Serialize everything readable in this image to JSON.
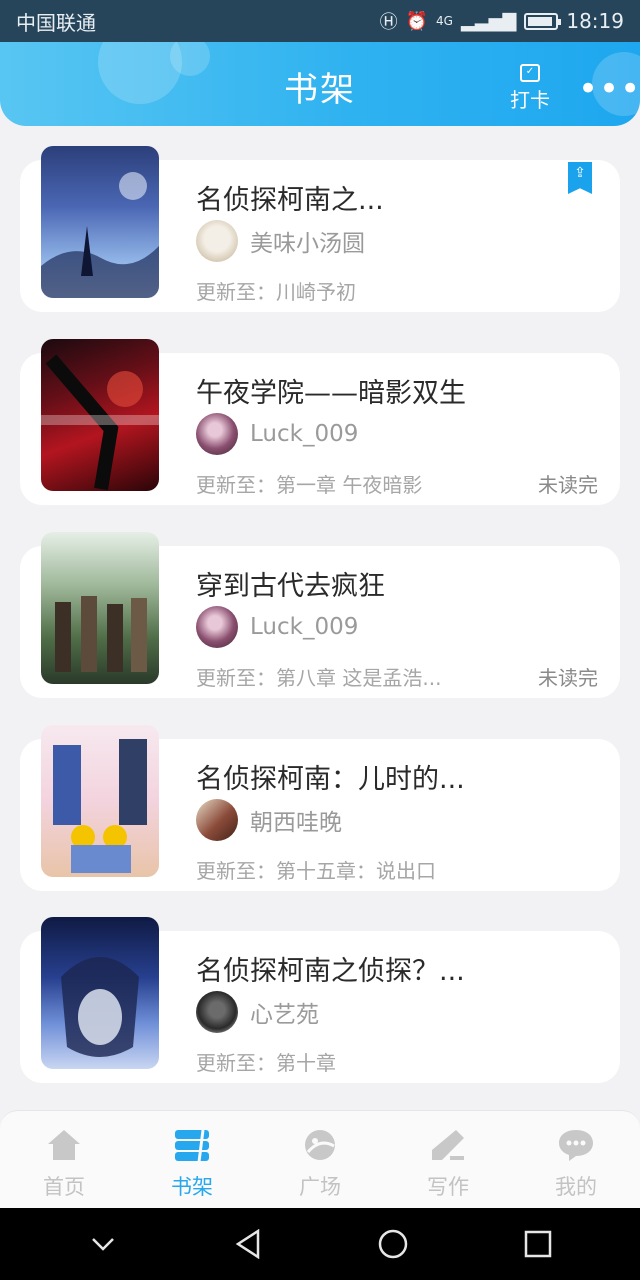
{
  "status_bar": {
    "carrier": "中国联通",
    "network": "4G",
    "time": "18:19",
    "battery_level": 0.9
  },
  "header": {
    "title": "书架",
    "checkin_label": "打卡",
    "more_label": "•••"
  },
  "books": [
    {
      "title": "名侦探柯南之...",
      "author": "美味小汤圆",
      "update": "更新至：川崎予初",
      "status": "",
      "pinned": true
    },
    {
      "title": "午夜学院——暗影双生",
      "author": "Luck_009",
      "update": "更新至：第一章  午夜暗影",
      "status": "未读完",
      "pinned": false
    },
    {
      "title": "穿到古代去疯狂",
      "author": "Luck_009",
      "update": "更新至：第八章  这是孟浩...",
      "status": "未读完",
      "pinned": false
    },
    {
      "title": "名侦探柯南：儿时的...",
      "author": "朝西哇晚",
      "update": "更新至：第十五章：说出口",
      "status": "",
      "pinned": false
    },
    {
      "title": "名侦探柯南之侦探？...",
      "author": "心艺苑",
      "update": "更新至：第十章",
      "status": "",
      "pinned": false
    }
  ],
  "bottom_nav": [
    {
      "label": "首页",
      "icon": "home-icon",
      "active": false
    },
    {
      "label": "书架",
      "icon": "bookshelf-icon",
      "active": true
    },
    {
      "label": "广场",
      "icon": "plaza-icon",
      "active": false
    },
    {
      "label": "写作",
      "icon": "write-icon",
      "active": false
    },
    {
      "label": "我的",
      "icon": "chat-bubble-icon",
      "active": false
    }
  ],
  "colors": {
    "accent": "#27a8ee",
    "header_start": "#58c6f2",
    "header_end": "#1ea7ef",
    "background": "#f2f2f4"
  }
}
